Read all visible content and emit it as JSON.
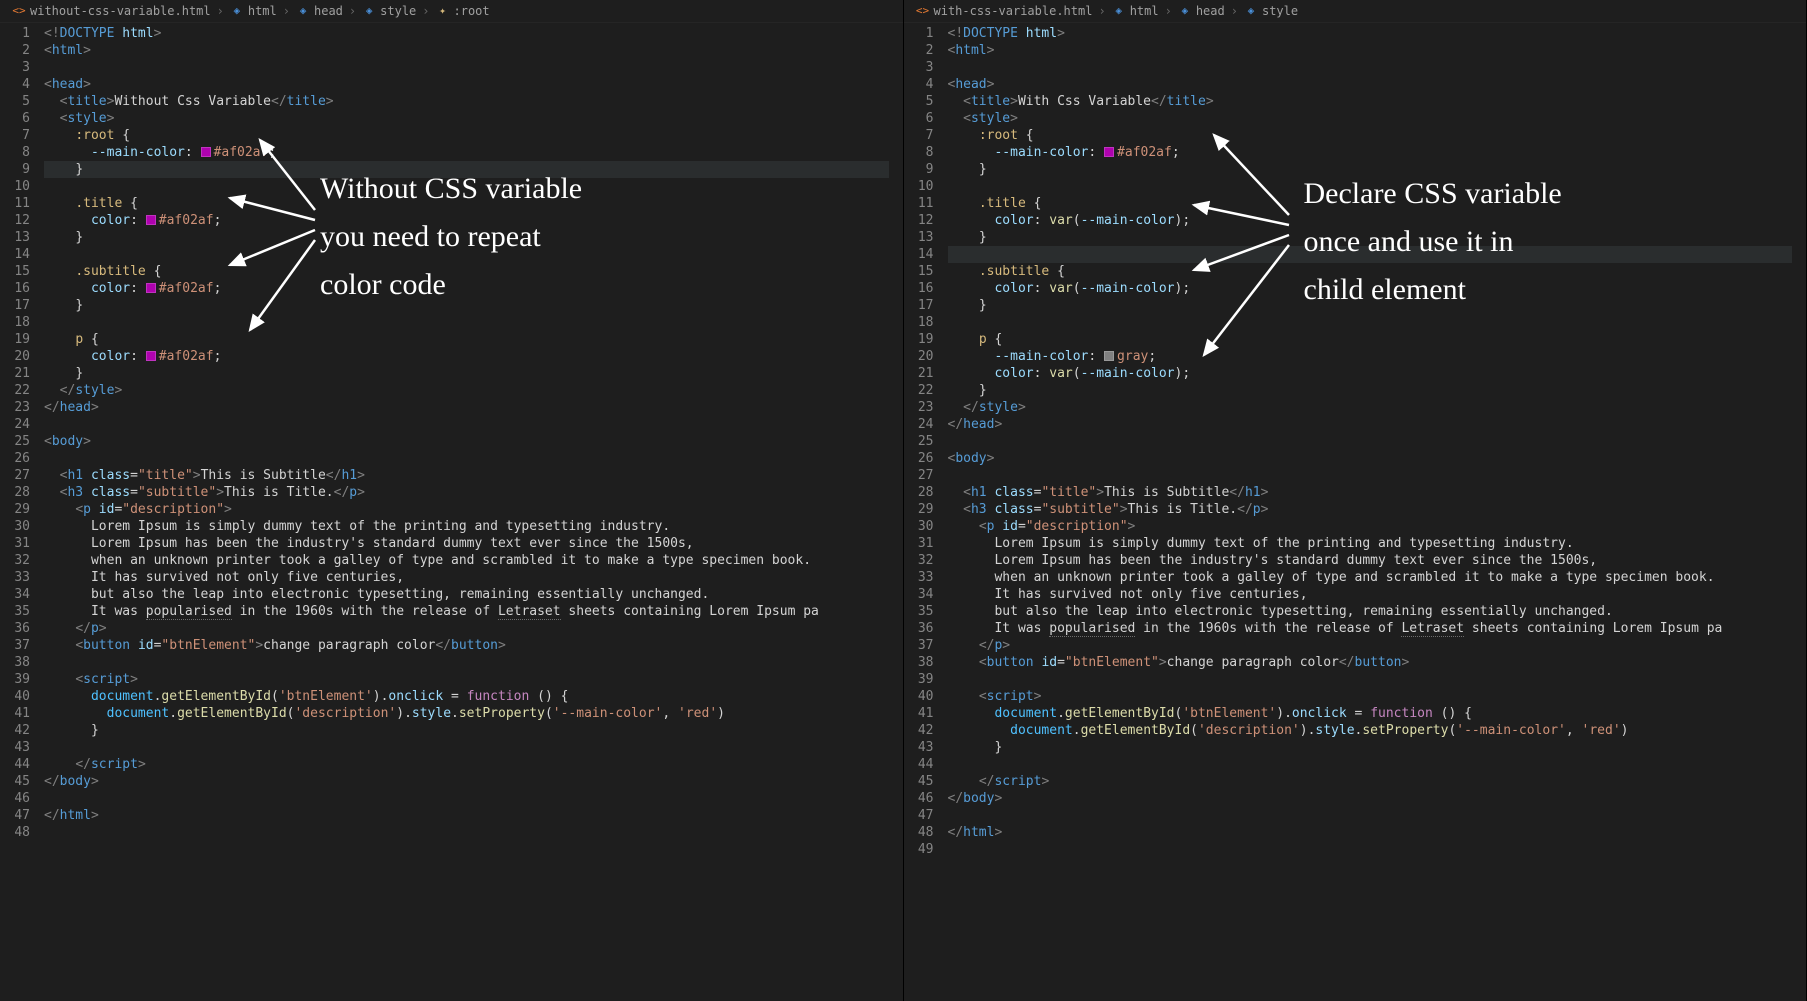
{
  "left": {
    "breadcrumbs": {
      "file": "without-css-variable.html",
      "path": [
        "html",
        "head",
        "style",
        ":root"
      ]
    },
    "annotation": {
      "text": "Without CSS variable\nyou need to repeat\ncolor code"
    },
    "code": [
      {
        "n": 1,
        "indent": 0,
        "type": "doctype",
        "text": "<!DOCTYPE html>"
      },
      {
        "n": 2,
        "indent": 0,
        "type": "tag-open",
        "tag": "html"
      },
      {
        "n": 3,
        "indent": 0,
        "type": "blank"
      },
      {
        "n": 4,
        "indent": 0,
        "type": "tag-open",
        "tag": "head"
      },
      {
        "n": 5,
        "indent": 1,
        "type": "tag-text",
        "tag": "title",
        "text": "Without Css Variable"
      },
      {
        "n": 6,
        "indent": 1,
        "type": "tag-open",
        "tag": "style"
      },
      {
        "n": 7,
        "indent": 2,
        "type": "css-sel-open",
        "sel": ":root"
      },
      {
        "n": 8,
        "indent": 3,
        "type": "css-prop-color",
        "prop": "--main-color",
        "color": "#af02af"
      },
      {
        "n": 9,
        "indent": 2,
        "type": "css-close",
        "hl": true
      },
      {
        "n": 10,
        "indent": 0,
        "type": "blank"
      },
      {
        "n": 11,
        "indent": 2,
        "type": "css-sel-open",
        "sel": ".title"
      },
      {
        "n": 12,
        "indent": 3,
        "type": "css-prop-color",
        "prop": "color",
        "color": "#af02af"
      },
      {
        "n": 13,
        "indent": 2,
        "type": "css-close"
      },
      {
        "n": 14,
        "indent": 0,
        "type": "blank"
      },
      {
        "n": 15,
        "indent": 2,
        "type": "css-sel-open",
        "sel": ".subtitle"
      },
      {
        "n": 16,
        "indent": 3,
        "type": "css-prop-color",
        "prop": "color",
        "color": "#af02af"
      },
      {
        "n": 17,
        "indent": 2,
        "type": "css-close"
      },
      {
        "n": 18,
        "indent": 0,
        "type": "blank"
      },
      {
        "n": 19,
        "indent": 2,
        "type": "css-sel-open",
        "sel": "p"
      },
      {
        "n": 20,
        "indent": 3,
        "type": "css-prop-color",
        "prop": "color",
        "color": "#af02af"
      },
      {
        "n": 21,
        "indent": 2,
        "type": "css-close"
      },
      {
        "n": 22,
        "indent": 1,
        "type": "tag-close",
        "tag": "style"
      },
      {
        "n": 23,
        "indent": 0,
        "type": "tag-close",
        "tag": "head"
      },
      {
        "n": 24,
        "indent": 0,
        "type": "blank"
      },
      {
        "n": 25,
        "indent": 0,
        "type": "tag-open",
        "tag": "body"
      },
      {
        "n": 26,
        "indent": 0,
        "type": "blank"
      },
      {
        "n": 27,
        "indent": 1,
        "type": "tag-attr-text",
        "tag": "h1",
        "attr": "class",
        "val": "title",
        "text": "This is Subtitle"
      },
      {
        "n": 28,
        "indent": 1,
        "type": "tag-attr-text",
        "tag": "h3",
        "attr": "class",
        "val": "subtitle",
        "text": "This is Title.",
        "closeTag": "p"
      },
      {
        "n": 29,
        "indent": 2,
        "type": "tag-attr-open",
        "tag": "p",
        "attr": "id",
        "val": "description"
      },
      {
        "n": 30,
        "indent": 3,
        "type": "text",
        "text": "Lorem Ipsum is simply dummy text of the printing and typesetting industry."
      },
      {
        "n": 31,
        "indent": 3,
        "type": "text",
        "text": "Lorem Ipsum has been the industry's standard dummy text ever since the 1500s,"
      },
      {
        "n": 32,
        "indent": 3,
        "type": "text",
        "text": "when an unknown printer took a galley of type and scrambled it to make a type specimen book."
      },
      {
        "n": 33,
        "indent": 3,
        "type": "text",
        "text": "It has survived not only five centuries,"
      },
      {
        "n": 34,
        "indent": 3,
        "type": "text",
        "text": "but also the leap into electronic typesetting, remaining essentially unchanged."
      },
      {
        "n": 35,
        "indent": 3,
        "type": "text-squiggle",
        "text": "It was ",
        "sq1": "popularised",
        "mid": " in the 1960s with the release of ",
        "sq2": "Letraset",
        "end": " sheets containing Lorem Ipsum pa"
      },
      {
        "n": 36,
        "indent": 2,
        "type": "tag-close",
        "tag": "p"
      },
      {
        "n": 37,
        "indent": 2,
        "type": "tag-attr-text",
        "tag": "button",
        "attr": "id",
        "val": "btnElement",
        "text": "change paragraph color"
      },
      {
        "n": 38,
        "indent": 0,
        "type": "blank"
      },
      {
        "n": 39,
        "indent": 2,
        "type": "tag-open",
        "tag": "script"
      },
      {
        "n": 40,
        "indent": 3,
        "type": "js1"
      },
      {
        "n": 41,
        "indent": 4,
        "type": "js2"
      },
      {
        "n": 42,
        "indent": 3,
        "type": "js-close"
      },
      {
        "n": 43,
        "indent": 0,
        "type": "blank"
      },
      {
        "n": 44,
        "indent": 2,
        "type": "tag-close",
        "tag": "script"
      },
      {
        "n": 45,
        "indent": 0,
        "type": "tag-close",
        "tag": "body"
      },
      {
        "n": 46,
        "indent": 0,
        "type": "blank"
      },
      {
        "n": 47,
        "indent": 0,
        "type": "tag-close",
        "tag": "html"
      },
      {
        "n": 48,
        "indent": 0,
        "type": "blank"
      }
    ]
  },
  "right": {
    "breadcrumbs": {
      "file": "with-css-variable.html",
      "path": [
        "html",
        "head",
        "style"
      ]
    },
    "annotation": {
      "text": "Declare CSS variable\nonce and use it in\nchild element"
    },
    "code": [
      {
        "n": 1,
        "indent": 0,
        "type": "doctype",
        "text": "<!DOCTYPE html>"
      },
      {
        "n": 2,
        "indent": 0,
        "type": "tag-open",
        "tag": "html"
      },
      {
        "n": 3,
        "indent": 0,
        "type": "blank"
      },
      {
        "n": 4,
        "indent": 0,
        "type": "tag-open",
        "tag": "head"
      },
      {
        "n": 5,
        "indent": 1,
        "type": "tag-text",
        "tag": "title",
        "text": "With Css Variable"
      },
      {
        "n": 6,
        "indent": 1,
        "type": "tag-open",
        "tag": "style"
      },
      {
        "n": 7,
        "indent": 2,
        "type": "css-sel-open",
        "sel": ":root"
      },
      {
        "n": 8,
        "indent": 3,
        "type": "css-prop-color",
        "prop": "--main-color",
        "color": "#af02af"
      },
      {
        "n": 9,
        "indent": 2,
        "type": "css-close"
      },
      {
        "n": 10,
        "indent": 0,
        "type": "blank"
      },
      {
        "n": 11,
        "indent": 2,
        "type": "css-sel-open",
        "sel": ".title"
      },
      {
        "n": 12,
        "indent": 3,
        "type": "css-prop-var",
        "prop": "color",
        "var": "--main-color"
      },
      {
        "n": 13,
        "indent": 2,
        "type": "css-close"
      },
      {
        "n": 14,
        "indent": 0,
        "type": "blank",
        "hl": true
      },
      {
        "n": 15,
        "indent": 2,
        "type": "css-sel-open",
        "sel": ".subtitle"
      },
      {
        "n": 16,
        "indent": 3,
        "type": "css-prop-var",
        "prop": "color",
        "var": "--main-color"
      },
      {
        "n": 17,
        "indent": 2,
        "type": "css-close"
      },
      {
        "n": 18,
        "indent": 0,
        "type": "blank"
      },
      {
        "n": 19,
        "indent": 2,
        "type": "css-sel-open",
        "sel": "p"
      },
      {
        "n": 20,
        "indent": 3,
        "type": "css-prop-swatch",
        "prop": "--main-color",
        "swatch": "gray",
        "val": "gray"
      },
      {
        "n": 21,
        "indent": 3,
        "type": "css-prop-var",
        "prop": "color",
        "var": "--main-color"
      },
      {
        "n": 22,
        "indent": 2,
        "type": "css-close"
      },
      {
        "n": 23,
        "indent": 1,
        "type": "tag-close",
        "tag": "style"
      },
      {
        "n": 24,
        "indent": 0,
        "type": "tag-close",
        "tag": "head"
      },
      {
        "n": 25,
        "indent": 0,
        "type": "blank"
      },
      {
        "n": 26,
        "indent": 0,
        "type": "tag-open",
        "tag": "body"
      },
      {
        "n": 27,
        "indent": 0,
        "type": "blank"
      },
      {
        "n": 28,
        "indent": 1,
        "type": "tag-attr-text",
        "tag": "h1",
        "attr": "class",
        "val": "title",
        "text": "This is Subtitle"
      },
      {
        "n": 29,
        "indent": 1,
        "type": "tag-attr-text",
        "tag": "h3",
        "attr": "class",
        "val": "subtitle",
        "text": "This is Title.",
        "closeTag": "p"
      },
      {
        "n": 30,
        "indent": 2,
        "type": "tag-attr-open",
        "tag": "p",
        "attr": "id",
        "val": "description"
      },
      {
        "n": 31,
        "indent": 3,
        "type": "text",
        "text": "Lorem Ipsum is simply dummy text of the printing and typesetting industry."
      },
      {
        "n": 32,
        "indent": 3,
        "type": "text",
        "text": "Lorem Ipsum has been the industry's standard dummy text ever since the 1500s,"
      },
      {
        "n": 33,
        "indent": 3,
        "type": "text",
        "text": "when an unknown printer took a galley of type and scrambled it to make a type specimen book."
      },
      {
        "n": 34,
        "indent": 3,
        "type": "text",
        "text": "It has survived not only five centuries,"
      },
      {
        "n": 35,
        "indent": 3,
        "type": "text",
        "text": "but also the leap into electronic typesetting, remaining essentially unchanged."
      },
      {
        "n": 36,
        "indent": 3,
        "type": "text-squiggle",
        "text": "It was ",
        "sq1": "popularised",
        "mid": " in the 1960s with the release of ",
        "sq2": "Letraset",
        "end": " sheets containing Lorem Ipsum pa"
      },
      {
        "n": 37,
        "indent": 2,
        "type": "tag-close",
        "tag": "p"
      },
      {
        "n": 38,
        "indent": 2,
        "type": "tag-attr-text",
        "tag": "button",
        "attr": "id",
        "val": "btnElement",
        "text": "change paragraph color"
      },
      {
        "n": 39,
        "indent": 0,
        "type": "blank"
      },
      {
        "n": 40,
        "indent": 2,
        "type": "tag-open",
        "tag": "script"
      },
      {
        "n": 41,
        "indent": 3,
        "type": "js1"
      },
      {
        "n": 42,
        "indent": 4,
        "type": "js2"
      },
      {
        "n": 43,
        "indent": 3,
        "type": "js-close"
      },
      {
        "n": 44,
        "indent": 0,
        "type": "blank"
      },
      {
        "n": 45,
        "indent": 2,
        "type": "tag-close",
        "tag": "script"
      },
      {
        "n": 46,
        "indent": 0,
        "type": "tag-close",
        "tag": "body"
      },
      {
        "n": 47,
        "indent": 0,
        "type": "blank"
      },
      {
        "n": 48,
        "indent": 0,
        "type": "tag-close",
        "tag": "html"
      },
      {
        "n": 49,
        "indent": 0,
        "type": "blank"
      }
    ]
  },
  "js": {
    "line1_parts": [
      "document",
      ".",
      "getElementById",
      "(",
      "'btnElement'",
      ")",
      ".",
      "onclick",
      " = ",
      "function",
      " () {"
    ],
    "line2_parts": [
      "document",
      ".",
      "getElementById",
      "(",
      "'description'",
      ")",
      ".",
      "style",
      ".",
      "setProperty",
      "(",
      "'--main-color'",
      ", ",
      "'red'",
      ")"
    ],
    "close": "}"
  }
}
